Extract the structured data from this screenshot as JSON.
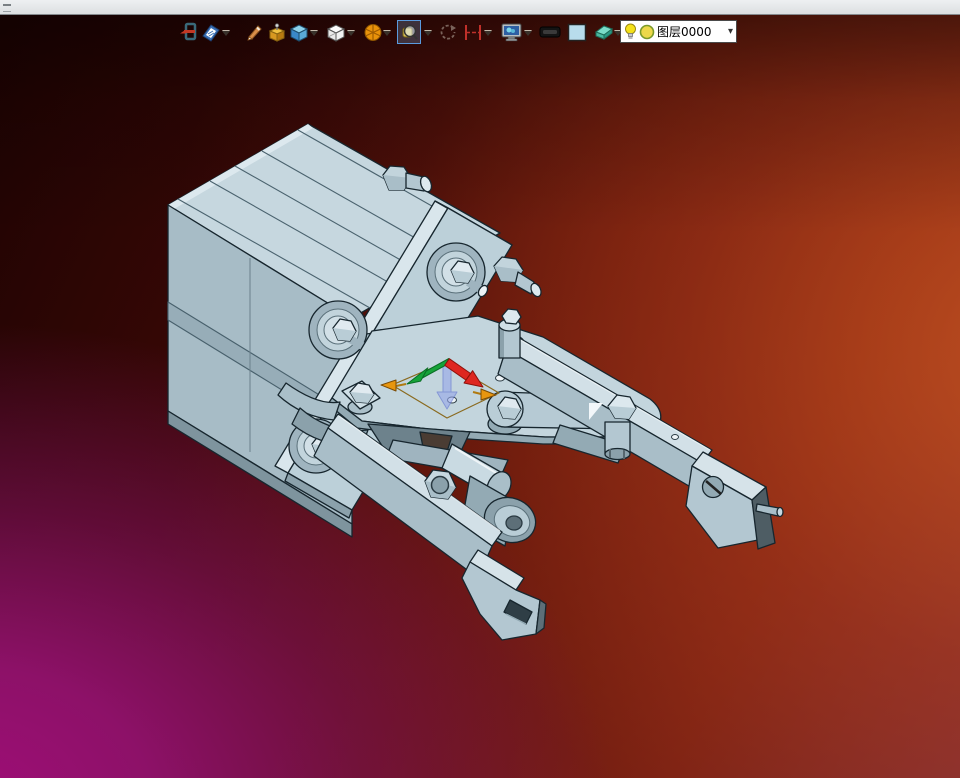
{
  "window": {
    "top_bar_color": "#e3e5e7"
  },
  "toolbar": {
    "icons": [
      {
        "name": "exit-icon"
      },
      {
        "name": "drawing-board-icon",
        "dropdown": true
      },
      {
        "name": "pencil-icon"
      },
      {
        "name": "pinned-box-icon"
      },
      {
        "name": "shaded-cube-icon",
        "dropdown": true
      },
      {
        "name": "wireframe-cube-icon",
        "dropdown": true
      },
      {
        "name": "orange-sphere-icon",
        "dropdown": true
      },
      {
        "name": "magnify-part-icon",
        "dropdown": true,
        "selected": true
      },
      {
        "name": "rotate-view-icon",
        "disabled": true
      },
      {
        "name": "dimension-icon",
        "dropdown": true
      },
      {
        "name": "render-display-icon",
        "dropdown": true
      },
      {
        "name": "line-weight-icon"
      },
      {
        "name": "color-swatch-icon"
      },
      {
        "name": "eraser-icon",
        "dropdown": true
      }
    ],
    "layer_selector": {
      "value": "图层0000",
      "icons": [
        "lightbulb-icon",
        "layer-color-icon"
      ],
      "dropdown_arrow": "▾"
    }
  },
  "viewport": {
    "model": "pneumatic-gripper-assembly",
    "parts": [
      "cylinder-block",
      "mounting-plate",
      "plate-bosses",
      "side-plugs",
      "gripper-base-plate",
      "pivot-links",
      "upper-gripper-arm",
      "upper-jaw",
      "lower-gripper-arm",
      "lower-jaw",
      "roller-cylinder"
    ],
    "triad": {
      "x_color": "#de2620",
      "y_color": "#16a339",
      "z_color": "#97a8ea",
      "handle_color": "#e8960f"
    }
  },
  "colors": {
    "background_top": "#1d0302",
    "background_right": "#9a3a1f",
    "background_bottom_left": "#8e0f6a",
    "body_light": "#c6d7df",
    "body_mid": "#a9bec8",
    "body_dark": "#5d6f78",
    "outline": "#17262e"
  }
}
